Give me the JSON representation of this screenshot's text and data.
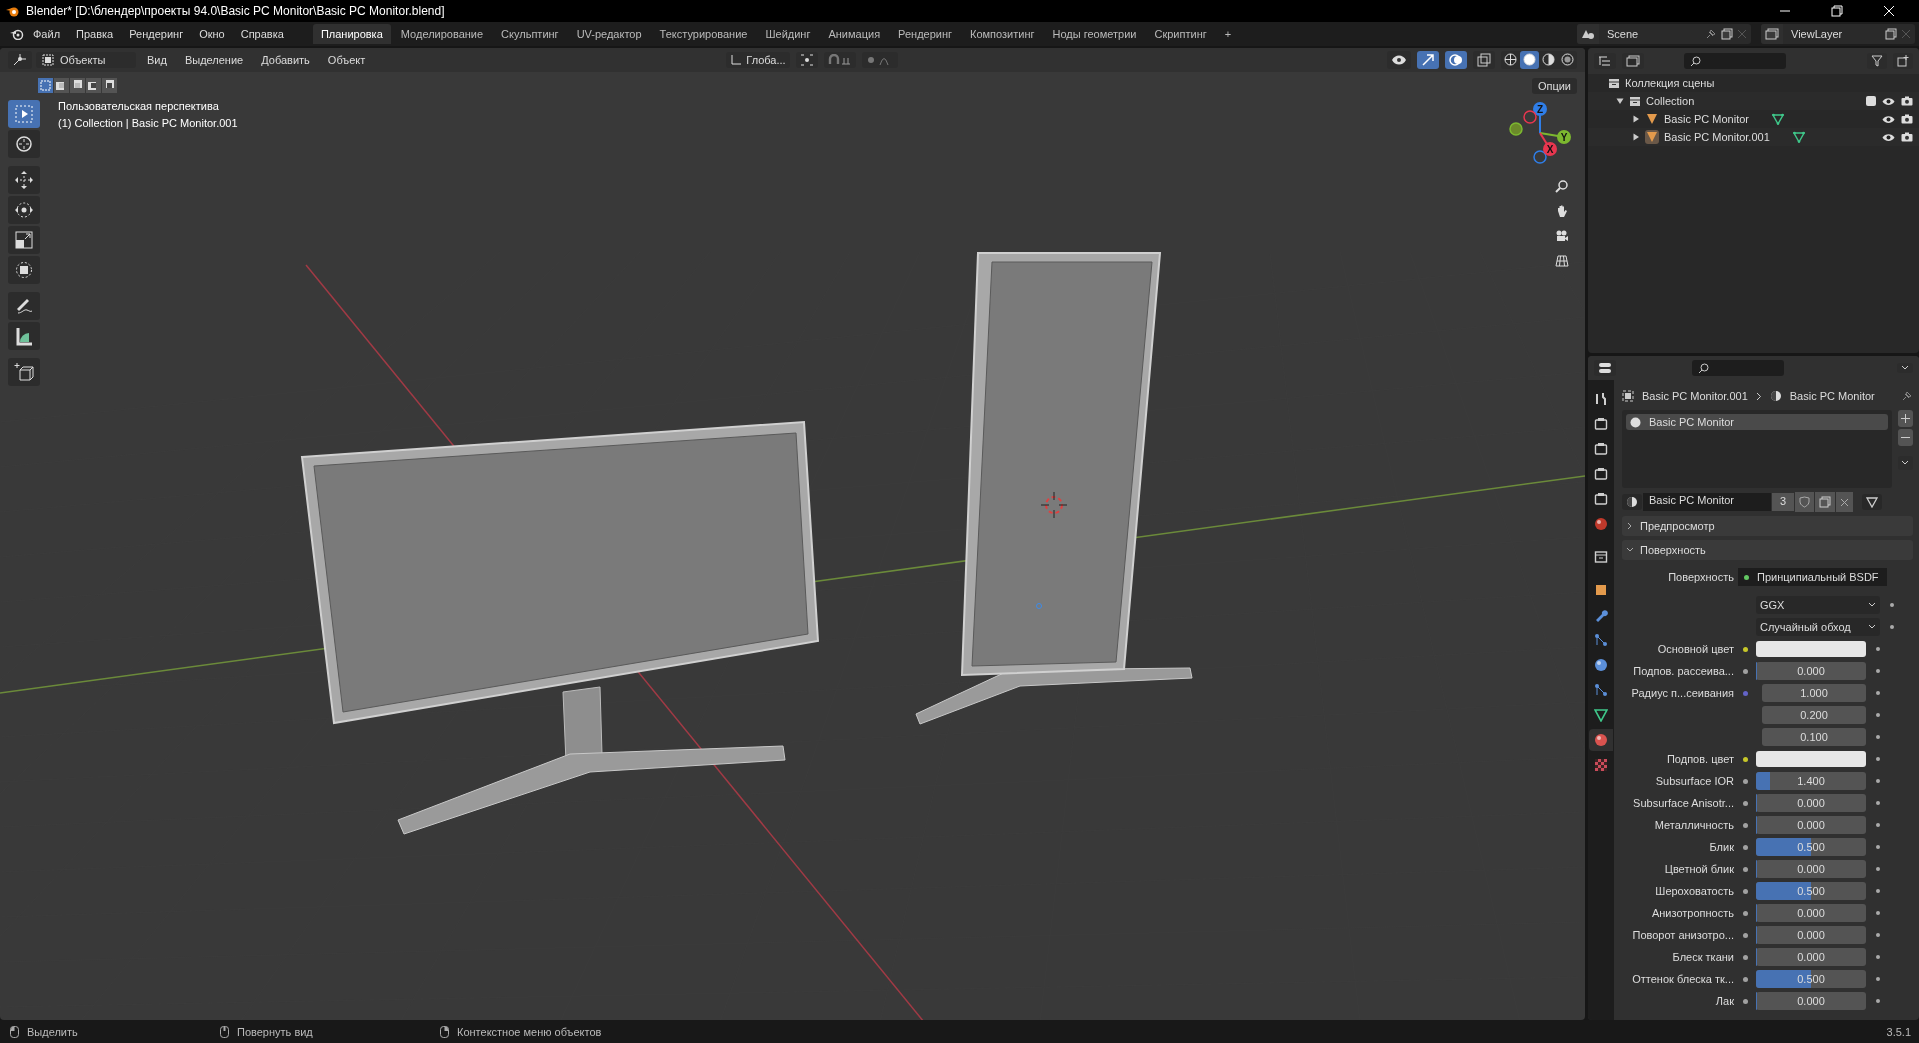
{
  "window": {
    "title": "Blender* [D:\\блендер\\проекты 94.0\\Basic PC Monitor\\Basic PC Monitor.blend]"
  },
  "menu": [
    "Файл",
    "Правка",
    "Рендеринг",
    "Окно",
    "Справка"
  ],
  "workspaces": [
    {
      "label": "Планировка",
      "selected": true
    },
    {
      "label": "Моделирование",
      "selected": false
    },
    {
      "label": "Скульптинг",
      "selected": false
    },
    {
      "label": "UV-редактор",
      "selected": false
    },
    {
      "label": "Текстурирование",
      "selected": false
    },
    {
      "label": "Шейдинг",
      "selected": false
    },
    {
      "label": "Анимация",
      "selected": false
    },
    {
      "label": "Рендеринг",
      "selected": false
    },
    {
      "label": "Композитинг",
      "selected": false
    },
    {
      "label": "Ноды геометрии",
      "selected": false
    },
    {
      "label": "Скриптинг",
      "selected": false
    }
  ],
  "add_workspace": "+",
  "scene": {
    "value": "Scene"
  },
  "view_layer": {
    "value": "ViewLayer"
  },
  "viewport": {
    "mode": "Объекты",
    "menu": [
      "Вид",
      "Выделение",
      "Добавить",
      "Объект"
    ],
    "orientation": "Глоба...",
    "options": "Опции",
    "view_name": "Пользовательская перспектива",
    "context": "(1) Collection | Basic PC Monitor.001",
    "select_modes": [
      {
        "selected": true
      },
      {
        "selected": false
      },
      {
        "selected": false
      },
      {
        "selected": false
      },
      {
        "selected": false
      }
    ],
    "shading": [
      {
        "selected": false
      },
      {
        "selected": true
      },
      {
        "selected": false
      },
      {
        "selected": false
      }
    ],
    "tools": [
      {
        "kind": "select",
        "selected": true
      },
      {
        "kind": "cursor",
        "selected": false
      },
      {
        "kind": "move",
        "selected": false
      },
      {
        "kind": "rotate",
        "selected": false
      },
      {
        "kind": "scale",
        "selected": false
      },
      {
        "kind": "transform",
        "selected": false
      },
      {
        "kind": "annotate",
        "selected": false
      },
      {
        "kind": "measure",
        "selected": false
      },
      {
        "kind": "add-cube",
        "selected": false
      }
    ],
    "gizmo": [
      "Z",
      "Y",
      "X"
    ]
  },
  "outliner": {
    "root": "Коллекция сцены",
    "collections": [
      {
        "label": "Collection",
        "expanded": true,
        "checked": true,
        "children": [
          {
            "label": "Basic PC Monitor",
            "selected": false
          },
          {
            "label": "Basic PC Monitor.001",
            "selected": true
          }
        ]
      }
    ]
  },
  "properties": {
    "tabs": [
      {
        "kind": "tool",
        "selected": false
      },
      {
        "kind": "render",
        "selected": false
      },
      {
        "kind": "output",
        "selected": false
      },
      {
        "kind": "view-layer",
        "selected": false
      },
      {
        "kind": "scene",
        "selected": false
      },
      {
        "kind": "world",
        "selected": false
      },
      {
        "kind": "collection",
        "selected": false
      },
      {
        "kind": "object",
        "selected": false
      },
      {
        "kind": "modifier",
        "selected": false
      },
      {
        "kind": "particles",
        "selected": false
      },
      {
        "kind": "physics",
        "selected": false
      },
      {
        "kind": "constraints",
        "selected": false
      },
      {
        "kind": "data",
        "selected": false
      },
      {
        "kind": "material",
        "selected": true
      },
      {
        "kind": "texture",
        "selected": false
      }
    ],
    "breadcrumb": [
      "Basic PC Monitor.001",
      "Basic PC Monitor"
    ],
    "slots": [
      {
        "label": "Basic PC Monitor",
        "selected": true
      }
    ],
    "material": {
      "name": "Basic PC Monitor",
      "users": "3"
    },
    "panels": [
      {
        "label": "Предпросмотр",
        "expanded": false
      },
      {
        "label": "Поверхность",
        "expanded": true
      }
    ],
    "fields": [
      {
        "kind": "link",
        "label": "Поверхность",
        "value": "Принципиальный BSDF",
        "color": "#63c763"
      },
      {
        "kind": "dropdown",
        "value": "GGX"
      },
      {
        "kind": "dropdown",
        "value": "Случайный обход"
      },
      {
        "kind": "color",
        "label": "Основной цвет",
        "color": "#c7c729"
      },
      {
        "kind": "number",
        "label": "Подпов. рассеива...",
        "value": "0.000",
        "level": 0,
        "color": "#a1a1a1"
      },
      {
        "kind": "vector",
        "label": "Радиус п...сеивания",
        "values": [
          "1.000",
          "0.200",
          "0.100"
        ],
        "color": "#6363c7"
      },
      {
        "kind": "color",
        "label": "Подпов. цвет",
        "color": "#c7c729"
      },
      {
        "kind": "number",
        "label": "Subsurface IOR",
        "value": "1.400",
        "level": 0.13,
        "color": "#a1a1a1"
      },
      {
        "kind": "number",
        "label": "Subsurface Anisotr...",
        "value": "0.000",
        "level": 0,
        "color": "#a1a1a1"
      },
      {
        "kind": "number",
        "label": "Металличность",
        "value": "0.000",
        "level": 0,
        "color": "#a1a1a1"
      },
      {
        "kind": "number",
        "label": "Блик",
        "value": "0.500",
        "level": 0.5,
        "color": "#a1a1a1"
      },
      {
        "kind": "number",
        "label": "Цветной блик",
        "value": "0.000",
        "level": 0,
        "color": "#a1a1a1"
      },
      {
        "kind": "number",
        "label": "Шероховатость",
        "value": "0.500",
        "level": 0.5,
        "color": "#a1a1a1"
      },
      {
        "kind": "number",
        "label": "Анизотропность",
        "value": "0.000",
        "level": 0,
        "color": "#a1a1a1"
      },
      {
        "kind": "number",
        "label": "Поворот анизотро...",
        "value": "0.000",
        "level": 0,
        "color": "#a1a1a1"
      },
      {
        "kind": "number",
        "label": "Блеск ткани",
        "value": "0.000",
        "level": 0,
        "color": "#a1a1a1"
      },
      {
        "kind": "number",
        "label": "Оттенок блеска тк...",
        "value": "0.500",
        "level": 0.5,
        "color": "#a1a1a1"
      },
      {
        "kind": "number",
        "label": "Лак",
        "value": "0.000",
        "level": 0,
        "color": "#a1a1a1"
      }
    ]
  },
  "status_bar": {
    "hints": [
      "Выделить",
      "Повернуть вид",
      "Контекстное меню объектов"
    ],
    "version": "3.5.1"
  }
}
